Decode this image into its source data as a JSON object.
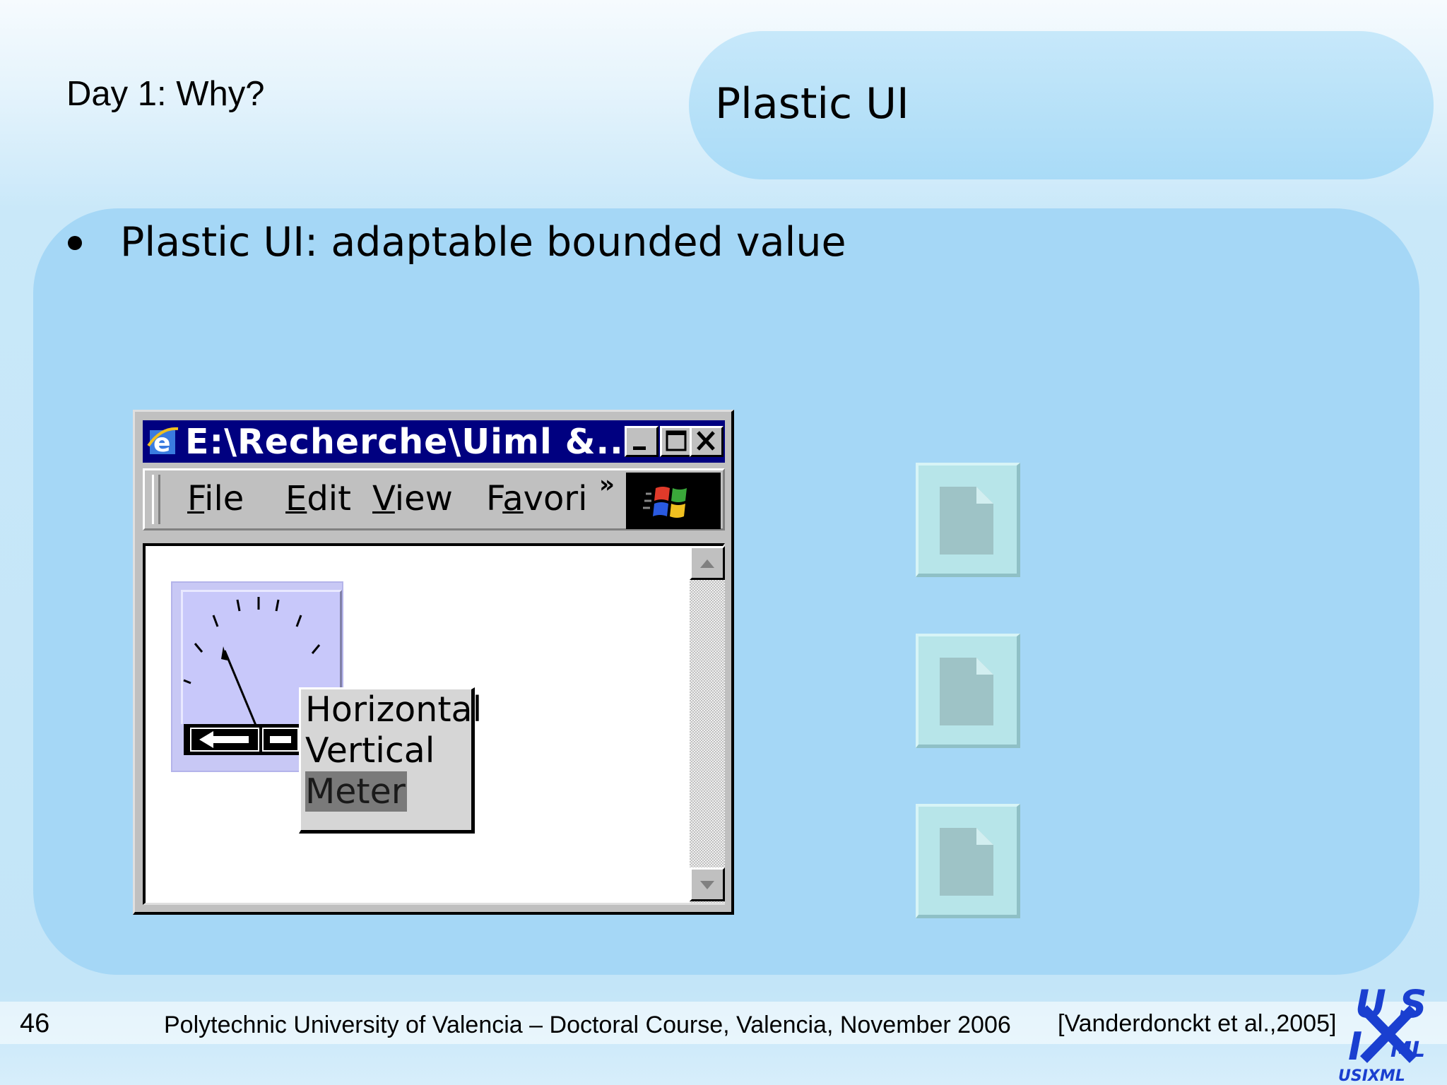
{
  "slide": {
    "section": "Day 1: Why?",
    "title": "Plastic UI",
    "bullet": "Plastic UI: adaptable bounded value",
    "page_number": "46",
    "footer": "Polytechnic University of Valencia – Doctoral Course, Valencia, November 2006",
    "citation": "[Vanderdonckt et al.,2005]",
    "logo_icon": "usixml-logo"
  },
  "window": {
    "title": "E:\\Recherche\\Uiml &...",
    "icon": "ie-icon",
    "controls": {
      "minimize_icon": "minimize-icon",
      "maximize_icon": "maximize-icon",
      "close_icon": "close-icon"
    },
    "menu": [
      {
        "key": "F",
        "rest": "ile"
      },
      {
        "key": "E",
        "rest": "dit"
      },
      {
        "key": "V",
        "rest": "iew"
      },
      {
        "pre": "F",
        "key": "a",
        "rest": "vori"
      }
    ],
    "menu_overflow": "»",
    "throbber_icon": "windows-logo-icon",
    "popup_items": [
      "Horizontal",
      "Vertical",
      "Meter"
    ],
    "popup_selected": "Meter"
  },
  "placeholders": [
    "document-icon",
    "document-icon",
    "document-icon"
  ],
  "colors": {
    "titlebar": "#000080",
    "panel": "#a5d7f6",
    "gauge": "#c8c8fa",
    "selection": "#7a7a7a"
  }
}
